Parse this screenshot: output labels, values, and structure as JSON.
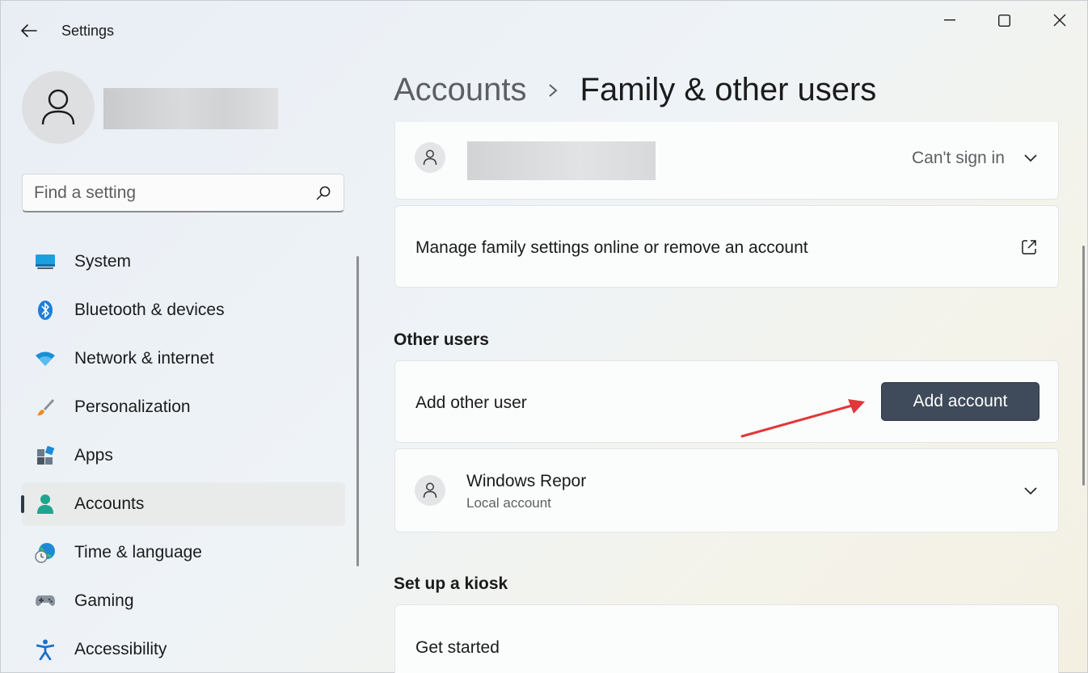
{
  "window": {
    "title": "Settings"
  },
  "search": {
    "placeholder": "Find a setting"
  },
  "nav": {
    "items": [
      {
        "label": "System",
        "icon": "monitor-icon"
      },
      {
        "label": "Bluetooth & devices",
        "icon": "bluetooth-icon"
      },
      {
        "label": "Network & internet",
        "icon": "wifi-icon"
      },
      {
        "label": "Personalization",
        "icon": "brush-icon"
      },
      {
        "label": "Apps",
        "icon": "apps-icon"
      },
      {
        "label": "Accounts",
        "icon": "person-icon",
        "selected": true
      },
      {
        "label": "Time & language",
        "icon": "globe-clock-icon"
      },
      {
        "label": "Gaming",
        "icon": "gamepad-icon"
      },
      {
        "label": "Accessibility",
        "icon": "accessibility-icon"
      }
    ]
  },
  "header": {
    "parent": "Accounts",
    "current": "Family & other users"
  },
  "family": {
    "member_status": "Can't sign in",
    "manage_label": "Manage family settings online or remove an account"
  },
  "other_users": {
    "heading": "Other users",
    "add_label": "Add other user",
    "add_button": "Add account",
    "user_name": "Windows Repor",
    "user_type": "Local account"
  },
  "kiosk": {
    "heading": "Set up a kiosk",
    "get_started": "Get started"
  },
  "colors": {
    "accent_button": "#3f4a5a",
    "annotation_arrow": "#e0383a"
  }
}
